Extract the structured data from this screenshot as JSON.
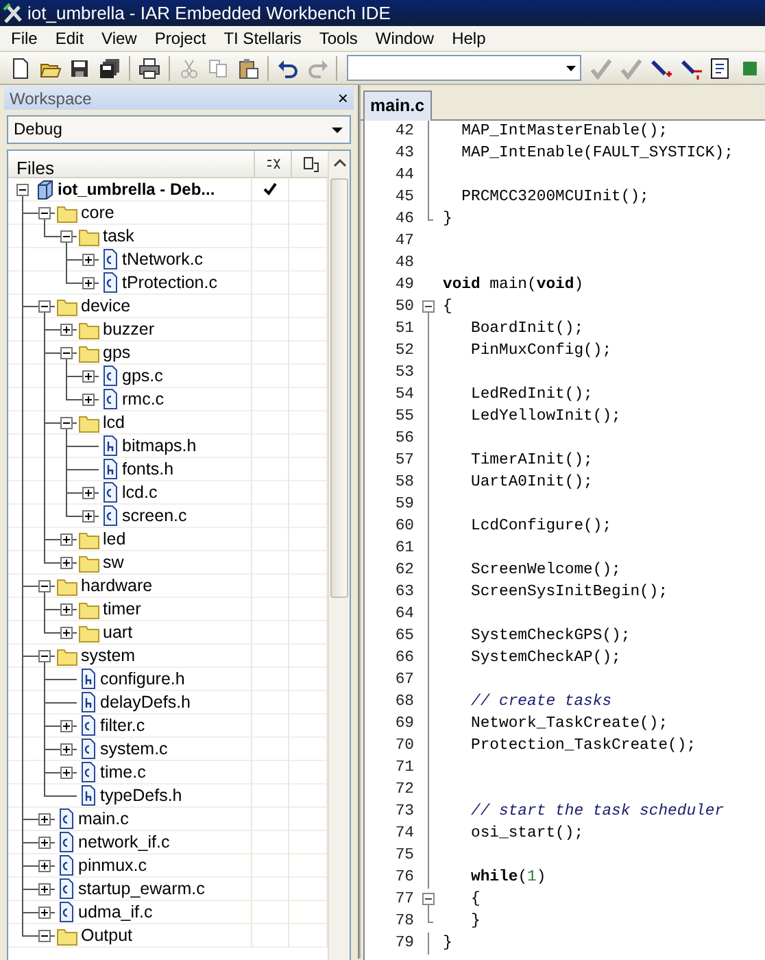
{
  "window": {
    "title": "iot_umbrella - IAR Embedded Workbench IDE"
  },
  "menu": [
    "File",
    "Edit",
    "View",
    "Project",
    "TI Stellaris",
    "Tools",
    "Window",
    "Help"
  ],
  "workspace": {
    "title": "Workspace",
    "close": "×",
    "configuration": "Debug",
    "column": "Files",
    "tree": [
      {
        "label": "iot_umbrella - Deb...",
        "kind": "project",
        "expanded": true,
        "checked": true,
        "children": [
          {
            "label": "core",
            "kind": "folder",
            "expanded": true,
            "children": [
              {
                "label": "task",
                "kind": "folder",
                "expanded": true,
                "children": [
                  {
                    "label": "tNetwork.c",
                    "kind": "c",
                    "expanded": false
                  },
                  {
                    "label": "tProtection.c",
                    "kind": "c",
                    "expanded": false
                  }
                ]
              }
            ]
          },
          {
            "label": "device",
            "kind": "folder",
            "expanded": true,
            "children": [
              {
                "label": "buzzer",
                "kind": "folder",
                "expanded": false
              },
              {
                "label": "gps",
                "kind": "folder",
                "expanded": true,
                "children": [
                  {
                    "label": "gps.c",
                    "kind": "c",
                    "expanded": false
                  },
                  {
                    "label": "rmc.c",
                    "kind": "c",
                    "expanded": false
                  }
                ]
              },
              {
                "label": "lcd",
                "kind": "folder",
                "expanded": true,
                "children": [
                  {
                    "label": "bitmaps.h",
                    "kind": "h"
                  },
                  {
                    "label": "fonts.h",
                    "kind": "h"
                  },
                  {
                    "label": "lcd.c",
                    "kind": "c",
                    "expanded": false
                  },
                  {
                    "label": "screen.c",
                    "kind": "c",
                    "expanded": false
                  }
                ]
              },
              {
                "label": "led",
                "kind": "folder",
                "expanded": false
              },
              {
                "label": "sw",
                "kind": "folder",
                "expanded": false
              }
            ]
          },
          {
            "label": "hardware",
            "kind": "folder",
            "expanded": true,
            "children": [
              {
                "label": "timer",
                "kind": "folder",
                "expanded": false
              },
              {
                "label": "uart",
                "kind": "folder",
                "expanded": false
              }
            ]
          },
          {
            "label": "system",
            "kind": "folder",
            "expanded": true,
            "children": [
              {
                "label": "configure.h",
                "kind": "h"
              },
              {
                "label": "delayDefs.h",
                "kind": "h"
              },
              {
                "label": "filter.c",
                "kind": "c",
                "expanded": false
              },
              {
                "label": "system.c",
                "kind": "c",
                "expanded": false
              },
              {
                "label": "time.c",
                "kind": "c",
                "expanded": false
              },
              {
                "label": "typeDefs.h",
                "kind": "h"
              }
            ]
          },
          {
            "label": "main.c",
            "kind": "c",
            "expanded": false
          },
          {
            "label": "network_if.c",
            "kind": "c",
            "expanded": false
          },
          {
            "label": "pinmux.c",
            "kind": "c",
            "expanded": false
          },
          {
            "label": "startup_ewarm.c",
            "kind": "c",
            "expanded": false
          },
          {
            "label": "udma_if.c",
            "kind": "c",
            "expanded": false
          },
          {
            "label": "Output",
            "kind": "folder",
            "expanded": true
          }
        ]
      }
    ]
  },
  "tabs": [
    {
      "label": "main.c",
      "selected": true
    }
  ],
  "editor": {
    "lines": [
      {
        "number": "42",
        "kind": "fold_line",
        "segments": [
          {
            "text": "  MAP_IntMasterEnable();",
            "kind": "plain"
          }
        ]
      },
      {
        "number": "43",
        "kind": "fold_line",
        "segments": [
          {
            "text": "  MAP_IntEnable(FAULT_SYSTICK);",
            "kind": "plain"
          }
        ]
      },
      {
        "number": "44",
        "kind": "fold_line"
      },
      {
        "number": "45",
        "kind": "fold_line",
        "segments": [
          {
            "text": "  PRCMCC3200MCUInit();",
            "kind": "plain"
          }
        ]
      },
      {
        "number": "46",
        "kind": "fold_end",
        "segments": [
          {
            "text": "}",
            "kind": "plain"
          }
        ]
      },
      {
        "number": "47",
        "kind": "plain"
      },
      {
        "number": "48",
        "kind": "plain"
      },
      {
        "number": "49",
        "kind": "plain",
        "segments": [
          {
            "text": "void",
            "kind": "keyword"
          },
          {
            "text": " main(",
            "kind": "plain"
          },
          {
            "text": "void",
            "kind": "keyword"
          },
          {
            "text": ")",
            "kind": "plain"
          }
        ]
      },
      {
        "number": "50",
        "kind": "fold_start",
        "segments": [
          {
            "text": "{",
            "kind": "plain"
          }
        ]
      },
      {
        "number": "51",
        "kind": "fold_line",
        "segments": [
          {
            "text": "   BoardInit();",
            "kind": "plain"
          }
        ]
      },
      {
        "number": "52",
        "kind": "fold_line",
        "segments": [
          {
            "text": "   PinMuxConfig();",
            "kind": "plain"
          }
        ]
      },
      {
        "number": "53",
        "kind": "fold_line"
      },
      {
        "number": "54",
        "kind": "fold_line",
        "segments": [
          {
            "text": "   LedRedInit();",
            "kind": "plain"
          }
        ]
      },
      {
        "number": "55",
        "kind": "fold_line",
        "segments": [
          {
            "text": "   LedYellowInit();",
            "kind": "plain"
          }
        ]
      },
      {
        "number": "56",
        "kind": "fold_line"
      },
      {
        "number": "57",
        "kind": "fold_line",
        "segments": [
          {
            "text": "   TimerAInit();",
            "kind": "plain"
          }
        ]
      },
      {
        "number": "58",
        "kind": "fold_line",
        "segments": [
          {
            "text": "   UartA0Init();",
            "kind": "plain"
          }
        ]
      },
      {
        "number": "59",
        "kind": "fold_line"
      },
      {
        "number": "60",
        "kind": "fold_line",
        "segments": [
          {
            "text": "   LcdConfigure();",
            "kind": "plain"
          }
        ]
      },
      {
        "number": "61",
        "kind": "fold_line"
      },
      {
        "number": "62",
        "kind": "fold_line",
        "segments": [
          {
            "text": "   ScreenWelcome();",
            "kind": "plain"
          }
        ]
      },
      {
        "number": "63",
        "kind": "fold_line",
        "segments": [
          {
            "text": "   ScreenSysInitBegin();",
            "kind": "plain"
          }
        ]
      },
      {
        "number": "64",
        "kind": "fold_line"
      },
      {
        "number": "65",
        "kind": "fold_line",
        "segments": [
          {
            "text": "   SystemCheckGPS();",
            "kind": "plain"
          }
        ]
      },
      {
        "number": "66",
        "kind": "fold_line",
        "segments": [
          {
            "text": "   SystemCheckAP();",
            "kind": "plain"
          }
        ]
      },
      {
        "number": "67",
        "kind": "fold_line"
      },
      {
        "number": "68",
        "kind": "fold_line",
        "segments": [
          {
            "text": "   // create tasks",
            "kind": "comment"
          }
        ]
      },
      {
        "number": "69",
        "kind": "fold_line",
        "segments": [
          {
            "text": "   Network_TaskCreate();",
            "kind": "plain"
          }
        ]
      },
      {
        "number": "70",
        "kind": "fold_line",
        "segments": [
          {
            "text": "   Protection_TaskCreate();",
            "kind": "plain"
          }
        ]
      },
      {
        "number": "71",
        "kind": "fold_line"
      },
      {
        "number": "72",
        "kind": "fold_line"
      },
      {
        "number": "73",
        "kind": "fold_line",
        "segments": [
          {
            "text": "   // start the task scheduler",
            "kind": "comment"
          }
        ]
      },
      {
        "number": "74",
        "kind": "fold_line",
        "segments": [
          {
            "text": "   osi_start();",
            "kind": "plain"
          }
        ]
      },
      {
        "number": "75",
        "kind": "fold_line"
      },
      {
        "number": "76",
        "kind": "fold_line",
        "segments": [
          {
            "text": "   while",
            "kind": "keyword"
          },
          {
            "text": "(",
            "kind": "plain"
          },
          {
            "text": "1",
            "kind": "number"
          },
          {
            "text": ")",
            "kind": "plain"
          }
        ]
      },
      {
        "number": "77",
        "kind": "fold_start",
        "segments": [
          {
            "text": "   {",
            "kind": "plain"
          }
        ]
      },
      {
        "number": "78",
        "kind": "fold_end",
        "segments": [
          {
            "text": "   }",
            "kind": "plain"
          }
        ]
      },
      {
        "number": "79",
        "kind": "fold_line",
        "segments": [
          {
            "text": "}",
            "kind": "plain"
          }
        ]
      }
    ]
  }
}
